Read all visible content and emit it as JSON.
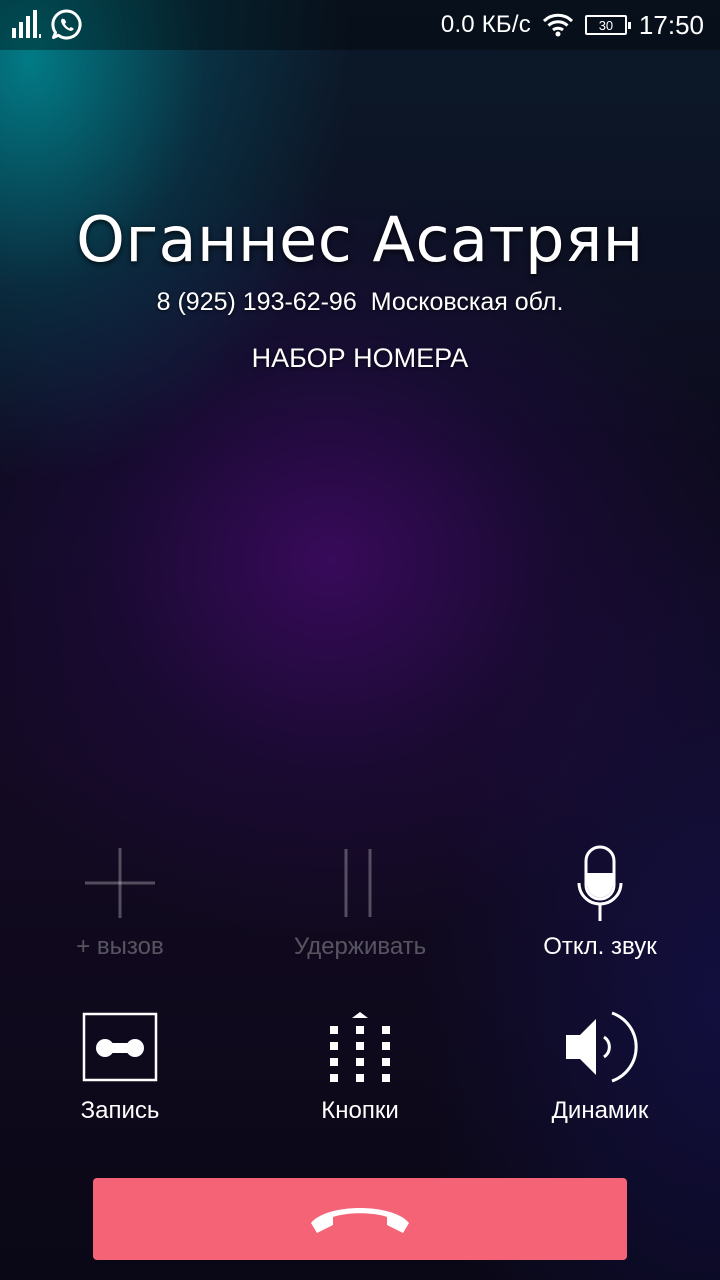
{
  "status_bar": {
    "net_speed": "0.0 КБ/с",
    "battery_level": "30",
    "time": "17:50",
    "left_icons": [
      "signal-icon",
      "whatsapp-icon"
    ],
    "right_icons": [
      "wifi-icon",
      "battery-icon"
    ]
  },
  "caller": {
    "name": "Оганнес Асатрян",
    "phone": "8 (925) 193-62-96",
    "region": "Московская обл.",
    "status": "НАБОР НОМЕРА"
  },
  "actions": {
    "add_call": {
      "label": "+ вызов",
      "icon": "plus-icon",
      "enabled": false
    },
    "hold": {
      "label": "Удерживать",
      "icon": "pause-icon",
      "enabled": false
    },
    "mute": {
      "label": "Откл. звук",
      "icon": "microphone-icon",
      "enabled": true
    },
    "record": {
      "label": "Запись",
      "icon": "voicemail-icon",
      "enabled": true
    },
    "keypad": {
      "label": "Кнопки",
      "icon": "dialpad-icon",
      "enabled": true
    },
    "speaker": {
      "label": "Динамик",
      "icon": "speaker-icon",
      "enabled": true
    }
  },
  "end_call": {
    "icon": "hang-up-icon",
    "color": "#f56377"
  }
}
